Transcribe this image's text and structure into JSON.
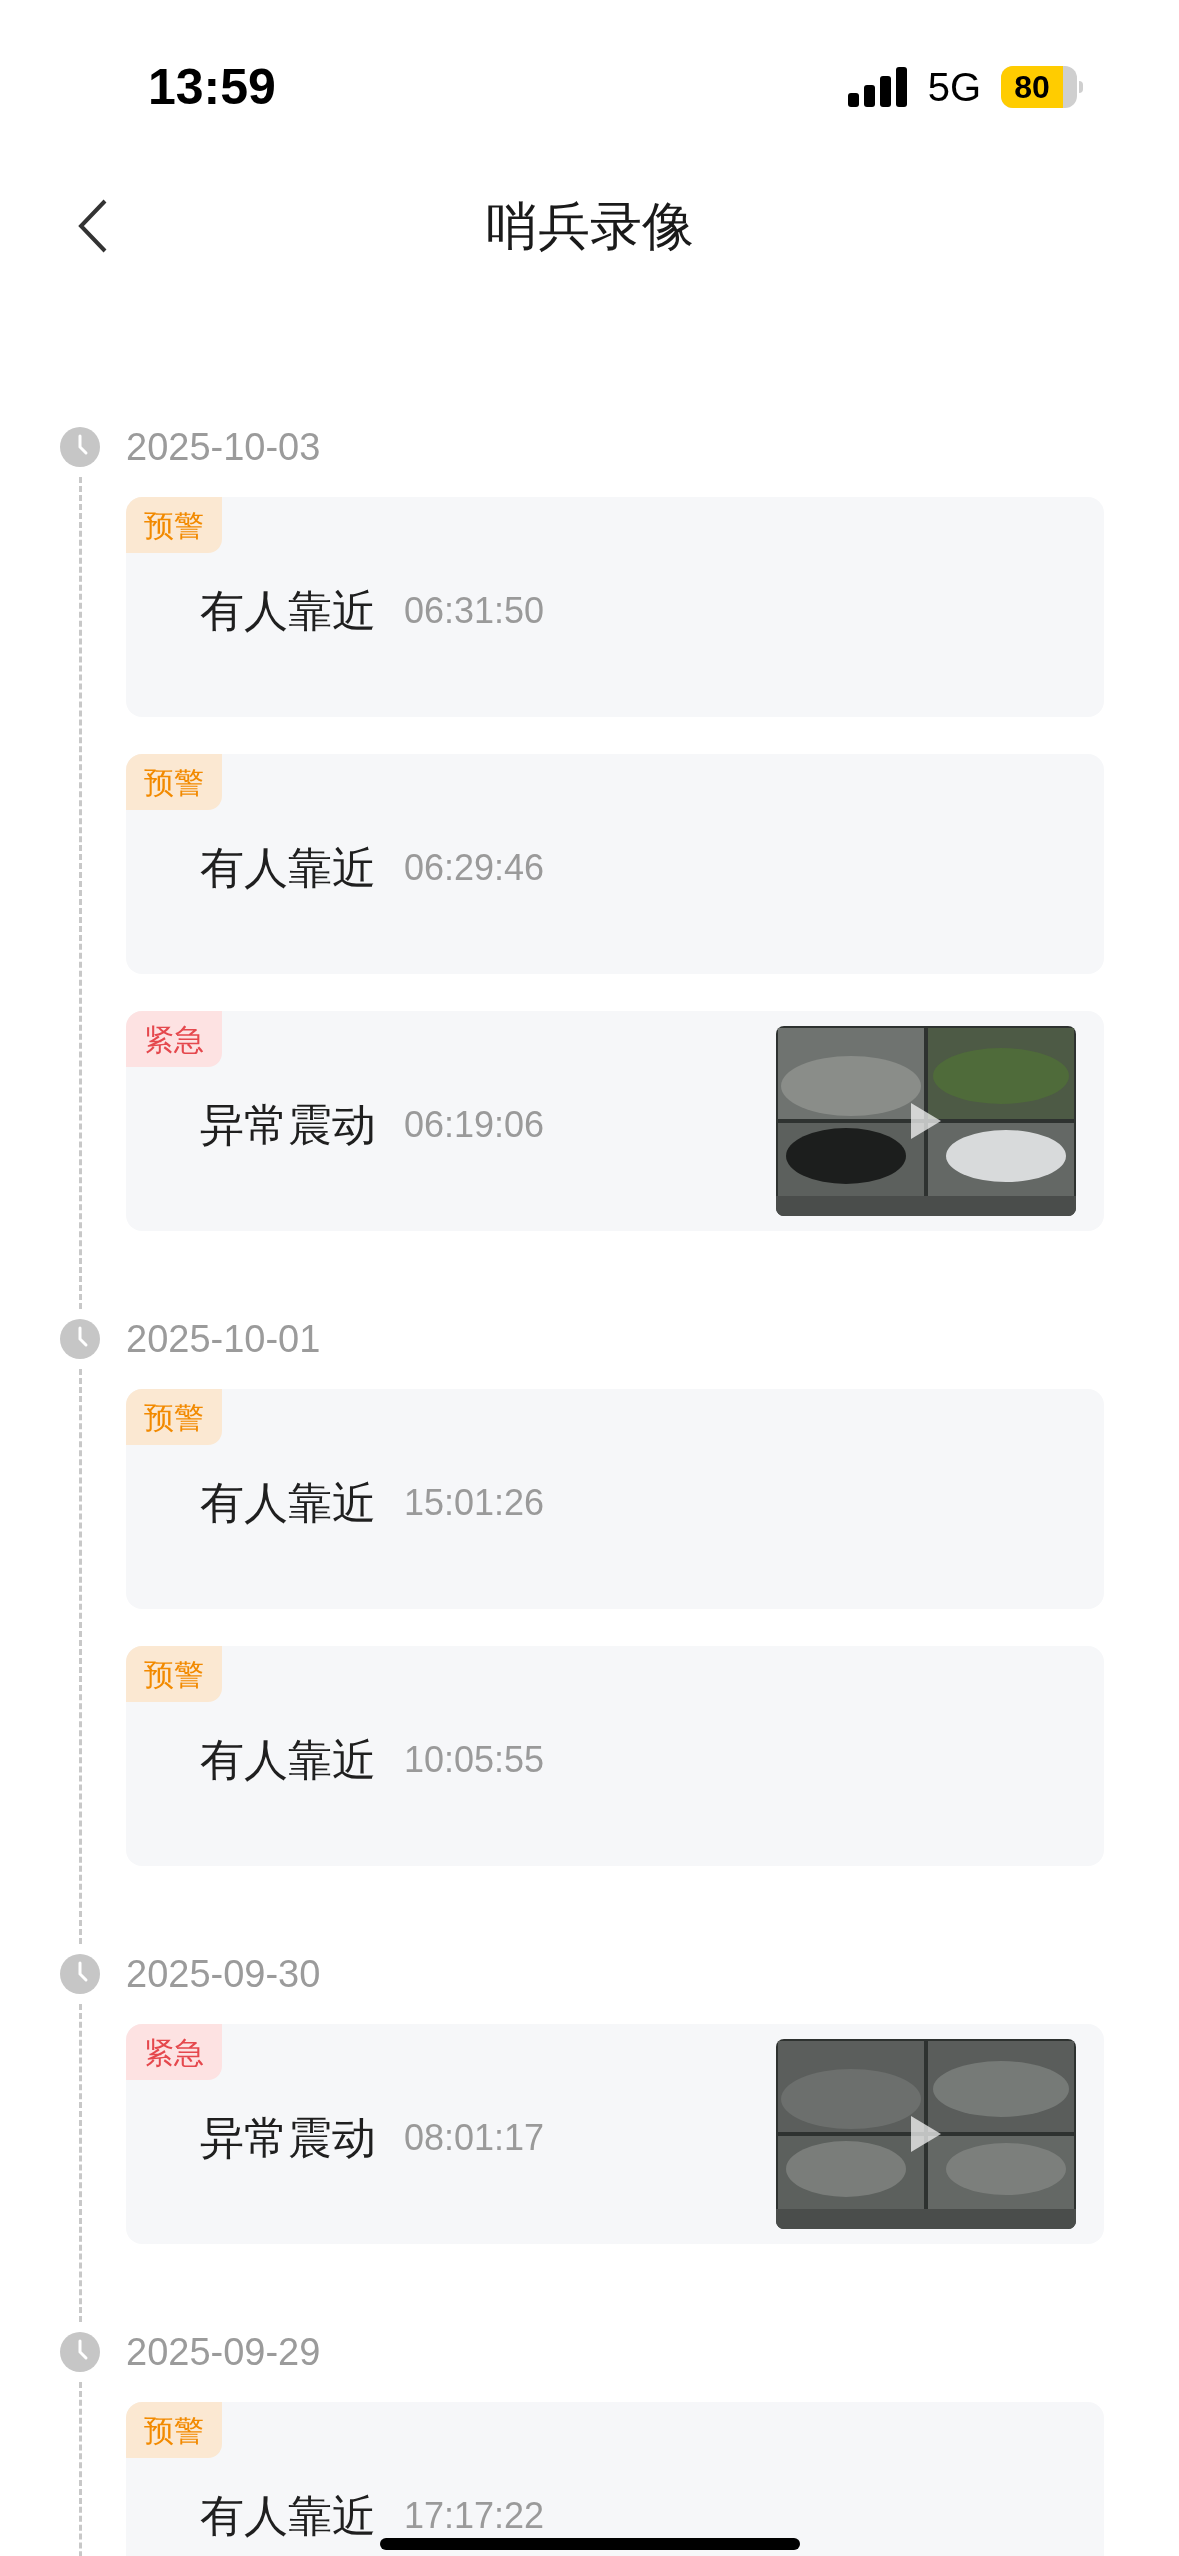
{
  "status_bar": {
    "time": "13:59",
    "network": "5G",
    "battery": "80"
  },
  "nav": {
    "title": "哨兵录像"
  },
  "groups": [
    {
      "date": "2025-10-03",
      "events": [
        {
          "tag": {
            "text": "预警",
            "kind": "warning"
          },
          "title": "有人靠近",
          "time": "06:31:50"
        },
        {
          "tag": {
            "text": "预警",
            "kind": "warning"
          },
          "title": "有人靠近",
          "time": "06:29:46"
        },
        {
          "tag": {
            "text": "紧急",
            "kind": "urgent"
          },
          "title": "异常震动",
          "time": "06:19:06"
        }
      ]
    },
    {
      "date": "2025-10-01",
      "events": [
        {
          "tag": {
            "text": "预警",
            "kind": "warning"
          },
          "title": "有人靠近",
          "time": "15:01:26"
        },
        {
          "tag": {
            "text": "预警",
            "kind": "warning"
          },
          "title": "有人靠近",
          "time": "10:05:55"
        }
      ]
    },
    {
      "date": "2025-09-30",
      "events": [
        {
          "tag": {
            "text": "紧急",
            "kind": "urgent"
          },
          "title": "异常震动",
          "time": "08:01:17"
        }
      ]
    },
    {
      "date": "2025-09-29",
      "events": [
        {
          "tag": {
            "text": "预警",
            "kind": "warning"
          },
          "title": "有人靠近",
          "time": "17:17:22"
        }
      ]
    }
  ]
}
